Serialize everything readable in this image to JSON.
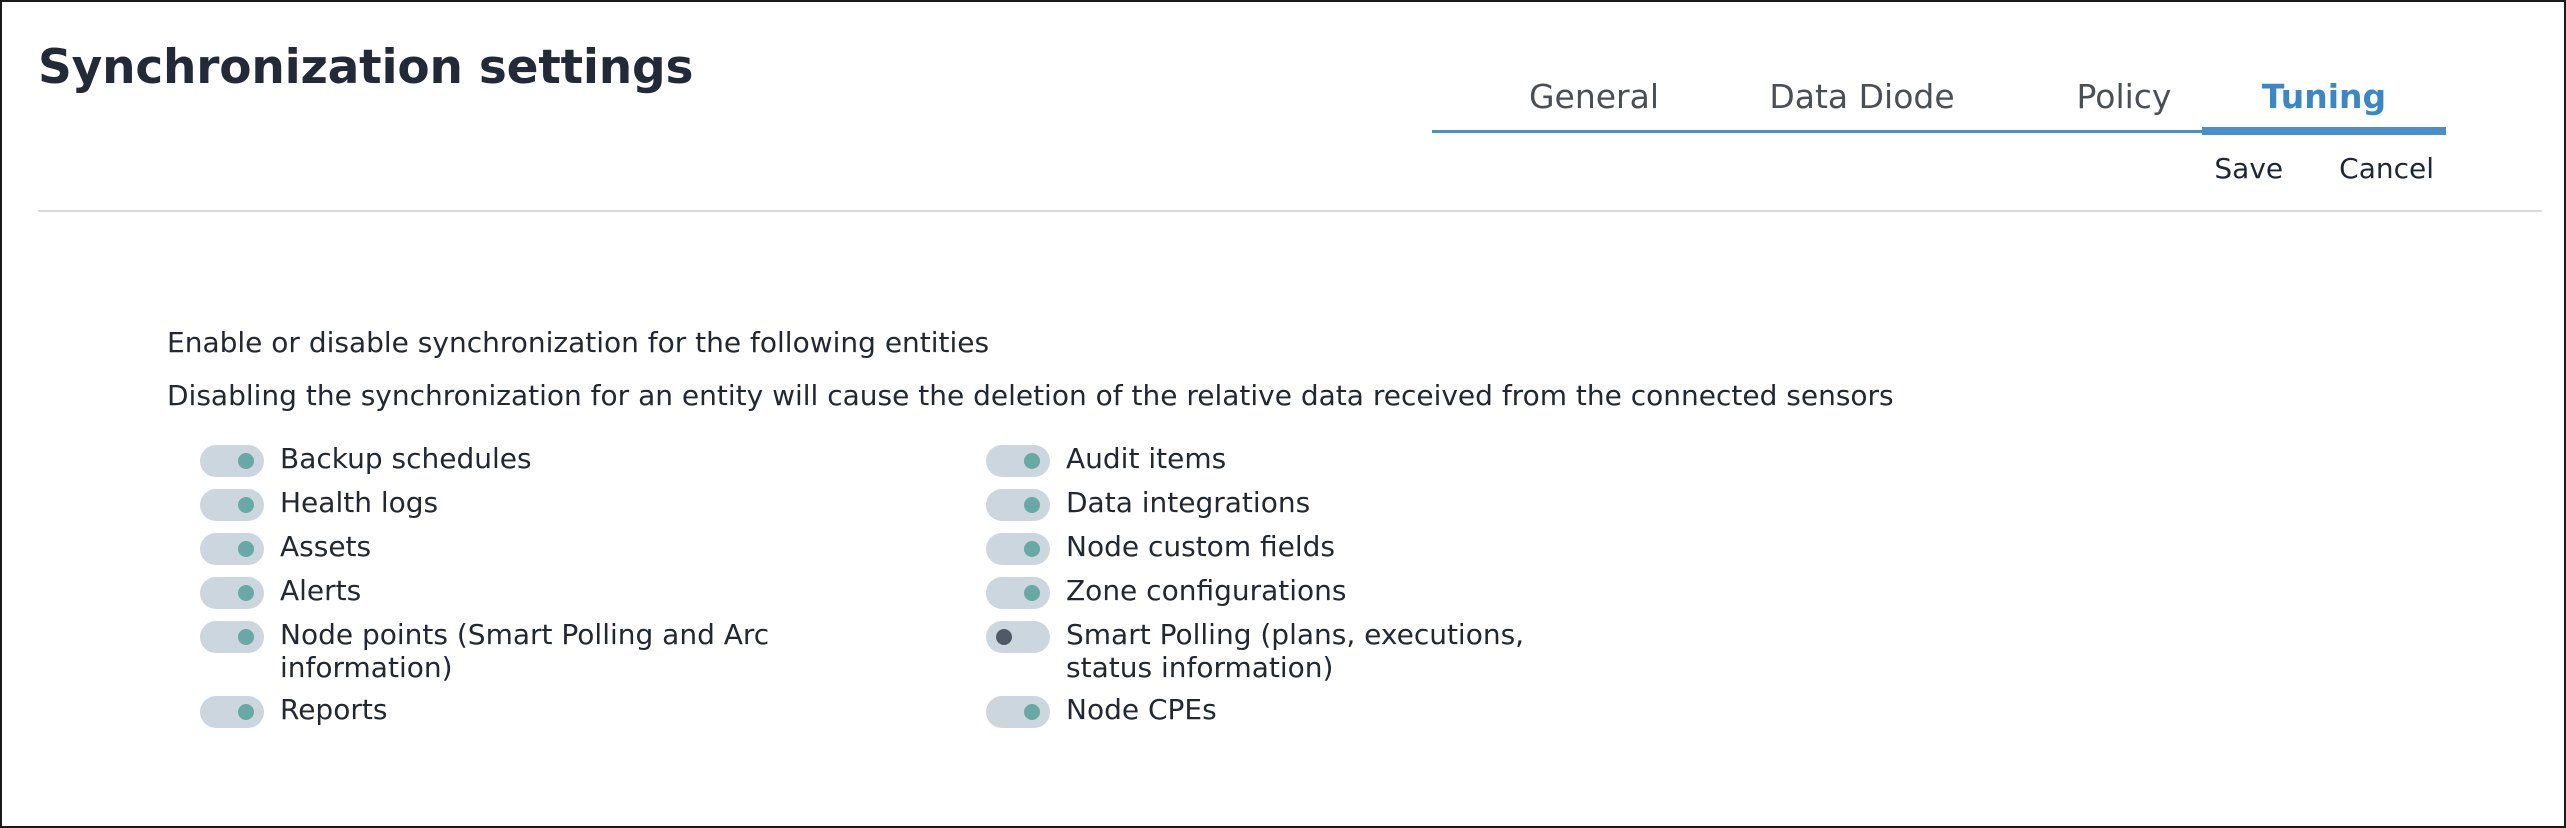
{
  "header": {
    "title": "Synchronization settings"
  },
  "tabs": [
    {
      "label": "General",
      "active": false
    },
    {
      "label": "Data Diode",
      "active": false
    },
    {
      "label": "Policy",
      "active": false
    },
    {
      "label": "Tuning",
      "active": true
    }
  ],
  "actions": {
    "save_label": "Save",
    "cancel_label": "Cancel"
  },
  "content": {
    "intro": "Enable or disable synchronization for the following entities",
    "warning": "Disabling the synchronization for an entity will cause the deletion of the relative data received from the connected sensors"
  },
  "entities_left": [
    {
      "label": "Backup schedules",
      "enabled": true
    },
    {
      "label": "Health logs",
      "enabled": true
    },
    {
      "label": "Assets",
      "enabled": true
    },
    {
      "label": "Alerts",
      "enabled": true
    },
    {
      "label": "Node points (Smart Polling and Arc information)",
      "enabled": true
    },
    {
      "label": "Reports",
      "enabled": true
    }
  ],
  "entities_right": [
    {
      "label": "Audit items",
      "enabled": true
    },
    {
      "label": "Data integrations",
      "enabled": true
    },
    {
      "label": "Node custom fields",
      "enabled": true
    },
    {
      "label": "Zone configurations",
      "enabled": true
    },
    {
      "label": "Smart Polling (plans, executions, status information)",
      "enabled": false
    },
    {
      "label": "Node CPEs",
      "enabled": true
    }
  ],
  "colors": {
    "accent": "#4a8fcb",
    "toggle_track": "#ccd6de",
    "toggle_knob_on": "#68a9a5",
    "toggle_knob_off": "#505a66"
  }
}
